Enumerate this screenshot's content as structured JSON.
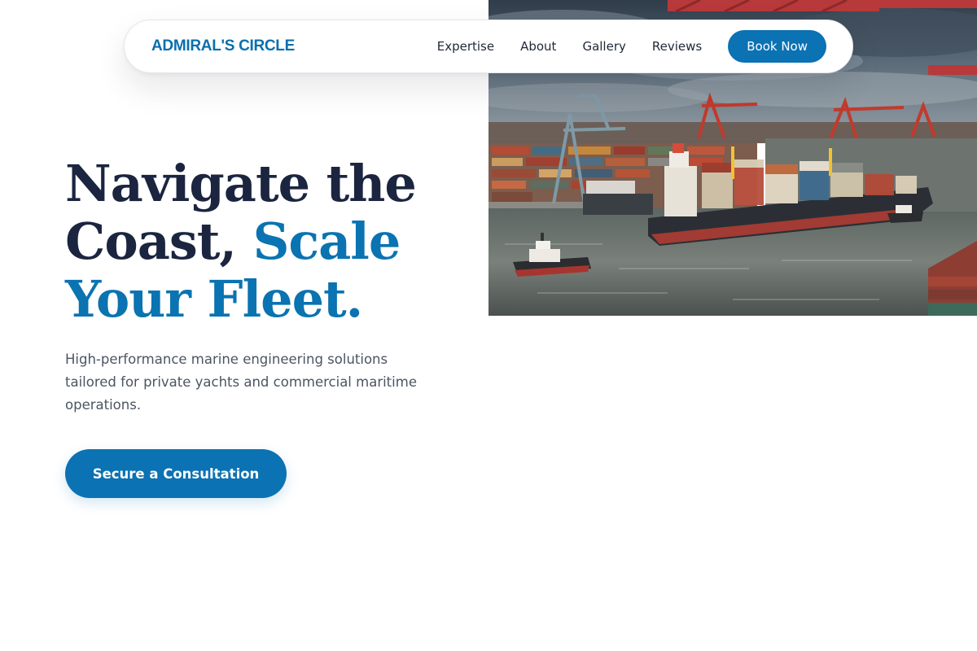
{
  "brand": {
    "name": "ADMIRAL'S CIRCLE"
  },
  "nav": {
    "links": [
      "Expertise",
      "About",
      "Gallery",
      "Reviews"
    ],
    "cta_label": "Book Now"
  },
  "hero": {
    "title_part1": "Navigate the Coast, ",
    "title_accent": "Scale Your Fleet.",
    "subtitle": "High-performance marine engineering solutions tailored for private yachts and commercial maritime operations.",
    "cta_label": "Secure a Consultation"
  },
  "colors": {
    "accent": "#0b72b3",
    "heading": "#1b2540",
    "body_text": "#4b5563",
    "nav_text": "#1f2937"
  }
}
